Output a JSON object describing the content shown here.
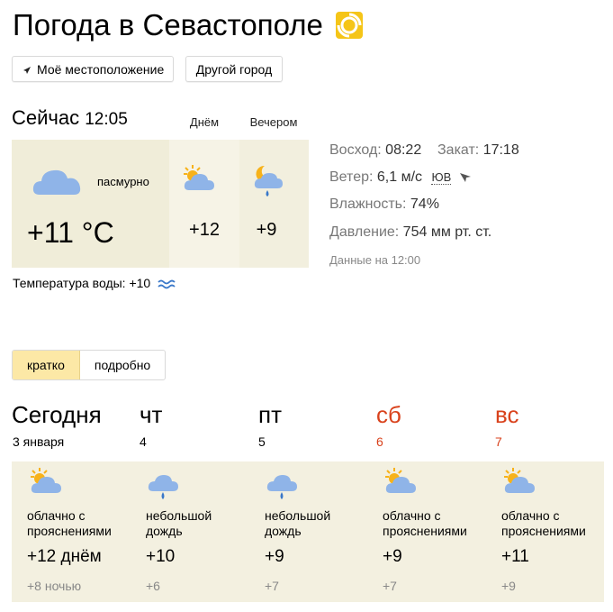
{
  "page": {
    "title": "Погода в Севастополе"
  },
  "buttons": {
    "location": "Моё местоположение",
    "other_city": "Другой город"
  },
  "current": {
    "label": "Сейчас",
    "time": "12:05",
    "day_col": "Днём",
    "evening_col": "Вечером",
    "condition": "пасмурно",
    "temp": "+11 °C",
    "day_temp": "+12",
    "evening_temp": "+9",
    "icon": "cloud-icon",
    "day_icon": "sun-cloud-icon",
    "evening_icon": "moon-cloud-rain-icon"
  },
  "details": {
    "sunrise_label": "Восход:",
    "sunrise": "08:22",
    "sunset_label": "Закат:",
    "sunset": "17:18",
    "wind_label": "Ветер:",
    "wind": "6,1 м/с",
    "wind_dir": "ЮВ",
    "humidity_label": "Влажность:",
    "humidity": "74%",
    "pressure_label": "Давление:",
    "pressure": "754 мм рт. ст.",
    "data_time": "Данные на 12:00"
  },
  "water": {
    "label": "Температура воды:",
    "temp": "+10"
  },
  "tabs": {
    "brief": "кратко",
    "detailed": "подробно",
    "active": "brief"
  },
  "forecast": [
    {
      "day": "Сегодня",
      "date": "3 января",
      "weekend": false,
      "icon": "sun-cloud-icon",
      "cond1": "облачно с",
      "cond2": "прояснениями",
      "temp": "+12 днём",
      "night": "+8 ночью"
    },
    {
      "day": "чт",
      "date": "4",
      "weekend": false,
      "icon": "cloud-rain-icon",
      "cond1": "небольшой",
      "cond2": "дождь",
      "temp": "+10",
      "night": "+6"
    },
    {
      "day": "пт",
      "date": "5",
      "weekend": false,
      "icon": "cloud-rain-icon",
      "cond1": "небольшой",
      "cond2": "дождь",
      "temp": "+9",
      "night": "+7"
    },
    {
      "day": "сб",
      "date": "6",
      "weekend": true,
      "icon": "sun-cloud-icon",
      "cond1": "облачно с",
      "cond2": "прояснениями",
      "temp": "+9",
      "night": "+7"
    },
    {
      "day": "вс",
      "date": "7",
      "weekend": true,
      "icon": "sun-cloud-icon",
      "cond1": "облачно с",
      "cond2": "прояснениями",
      "temp": "+11",
      "night": "+9"
    }
  ],
  "colors": {
    "weekend": "#d9421c",
    "panel": "#f0edd9",
    "active_tab": "#fce8a6",
    "cloud": "#8fb4e8",
    "sun": "#f7b21a",
    "rain": "#3a78c9"
  }
}
